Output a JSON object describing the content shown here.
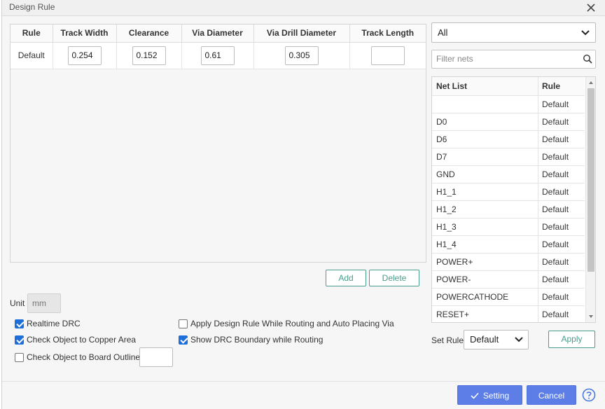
{
  "dialog": {
    "title": "Design Rule"
  },
  "rules_table": {
    "headers": [
      "Rule",
      "Track Width",
      "Clearance",
      "Via Diameter",
      "Via Drill Diameter",
      "Track Length"
    ],
    "rows": [
      {
        "rule": "Default",
        "track_width": "0.254",
        "clearance": "0.152",
        "via_diameter": "0.61",
        "via_drill_diameter": "0.305",
        "track_length": ""
      }
    ]
  },
  "actions": {
    "add_label": "Add",
    "delete_label": "Delete"
  },
  "unit": {
    "label": "Unit",
    "value": "mm"
  },
  "options": {
    "realtime_drc": {
      "label": "Realtime DRC",
      "checked": true
    },
    "check_copper_area": {
      "label": "Check Object to Copper Area",
      "checked": true
    },
    "check_board_outline": {
      "label": "Check Object to Board Outline",
      "checked": false,
      "value": ""
    },
    "apply_while_routing": {
      "label": "Apply Design Rule While Routing and Auto Placing Via",
      "checked": false
    },
    "show_drc_boundary": {
      "label": "Show DRC Boundary while Routing",
      "checked": true
    }
  },
  "net_filter": {
    "selected": "All",
    "placeholder": "Filter nets"
  },
  "net_list": {
    "headers": [
      "Net List",
      "Rule"
    ],
    "rows": [
      {
        "net": "",
        "rule": "Default"
      },
      {
        "net": "D0",
        "rule": "Default"
      },
      {
        "net": "D6",
        "rule": "Default"
      },
      {
        "net": "D7",
        "rule": "Default"
      },
      {
        "net": "GND",
        "rule": "Default"
      },
      {
        "net": "H1_1",
        "rule": "Default"
      },
      {
        "net": "H1_2",
        "rule": "Default"
      },
      {
        "net": "H1_3",
        "rule": "Default"
      },
      {
        "net": "H1_4",
        "rule": "Default"
      },
      {
        "net": "POWER+",
        "rule": "Default"
      },
      {
        "net": "POWER-",
        "rule": "Default"
      },
      {
        "net": "POWERCATHODE",
        "rule": "Default"
      },
      {
        "net": "RESET+",
        "rule": "Default"
      }
    ]
  },
  "set_rule": {
    "label": "Set Rule",
    "selected": "Default",
    "apply_label": "Apply"
  },
  "footer": {
    "setting_label": "Setting",
    "cancel_label": "Cancel"
  }
}
